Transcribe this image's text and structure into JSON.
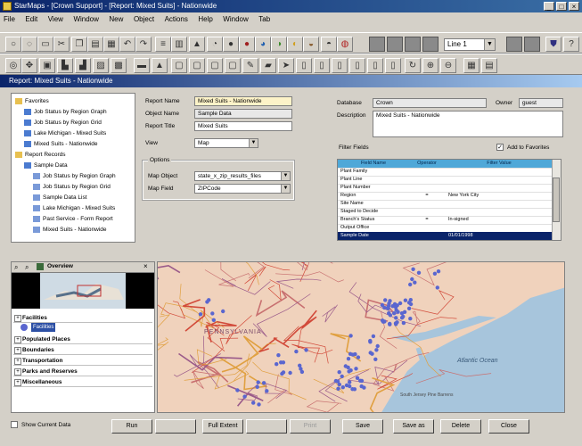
{
  "window": {
    "title": "StarMaps - [Crown Support] - [Report: Mixed Suits] - Nationwide"
  },
  "menu": [
    "File",
    "Edit",
    "View",
    "Window",
    "New",
    "Object",
    "Actions",
    "Help",
    "Window",
    "Tab"
  ],
  "line_select": {
    "value": "Line 1"
  },
  "doc_title": "Report: Mixed Suits - Nationwide",
  "tree": [
    {
      "label": "Favorites",
      "level": 0
    },
    {
      "label": "Job Status by Region Graph",
      "level": 1
    },
    {
      "label": "Job Status by Region Grid",
      "level": 1
    },
    {
      "label": "Lake Michigan - Mixed Suits",
      "level": 1
    },
    {
      "label": "Mixed Suits - Nationwide",
      "level": 1
    },
    {
      "label": "Report Records",
      "level": 0
    },
    {
      "label": "Sample Data",
      "level": 1
    },
    {
      "label": "Job Status by Region Graph",
      "level": 2
    },
    {
      "label": "Job Status by Region Grid",
      "level": 2
    },
    {
      "label": "Sample Data List",
      "level": 2
    },
    {
      "label": "Lake Michigan - Mixed Suits",
      "level": 2
    },
    {
      "label": "Past Service - Form Report",
      "level": 2
    },
    {
      "label": "Mixed Suits - Nationwide",
      "level": 2
    }
  ],
  "form": {
    "report_name_label": "Report Name",
    "report_name_value": "Mixed Suits - Nationwide",
    "object_name_label": "Object Name",
    "object_name_value": "Sample Data",
    "report_title_label": "Report Title",
    "report_title_value": "Mixed Suits",
    "view_label": "View",
    "view_value": "Map",
    "options_label": "Options",
    "map_object_label": "Map Object",
    "map_object_value": "state_x_zip_results_files",
    "map_field_label": "Map Field",
    "map_field_value": "ZIPCode",
    "database_label": "Database",
    "database_value": "Crown",
    "owner_label": "Owner",
    "owner_value": "guest",
    "description_label": "Description",
    "description_value": "Mixed Suits - Nationwide",
    "filter_fields_label": "Filter Fields",
    "add_to_favorites_label": "Add to Favorites"
  },
  "filter_table": {
    "headers": [
      "Field Name",
      "Operator",
      "Filter Value"
    ],
    "rows": [
      [
        "Plant Family",
        "",
        ""
      ],
      [
        "Plant Line",
        "",
        ""
      ],
      [
        "Plant Number",
        "",
        ""
      ],
      [
        "Region",
        "=",
        "New York City"
      ],
      [
        "Site Name",
        "",
        ""
      ],
      [
        "Staged to Decide",
        "",
        ""
      ],
      [
        "Branch's Status",
        "=",
        "In-signed"
      ],
      [
        "Output Office",
        "",
        ""
      ],
      [
        "Sample Date",
        "",
        "01/01/1998"
      ]
    ]
  },
  "overview": {
    "title": "Overview",
    "layers": [
      "Facilities",
      "Populated Places",
      "Boundaries",
      "Transportation",
      "Parks and Reserves",
      "Miscellaneous"
    ],
    "facility_item": "Facilities"
  },
  "map_labels": {
    "ocean": "Atlantic Ocean",
    "state": "PENNSYLVANIA",
    "park": "South Jersey Pine Barrens"
  },
  "footer": {
    "checkbox_label": "Show Current Data",
    "buttons": [
      "Run",
      "",
      "Full Extent",
      "",
      "Print",
      "Save",
      "Save as",
      "Delete",
      "Close"
    ]
  },
  "colors": {
    "title_bar": "#0a246a",
    "title_bar_end": "#3a6ea5",
    "doc_title_end": "#a6caf0",
    "chrome": "#d4d0c8",
    "ocean": "#a7c5dc",
    "map_land": "#f0d2bc",
    "map_points": "#5a66cf"
  }
}
